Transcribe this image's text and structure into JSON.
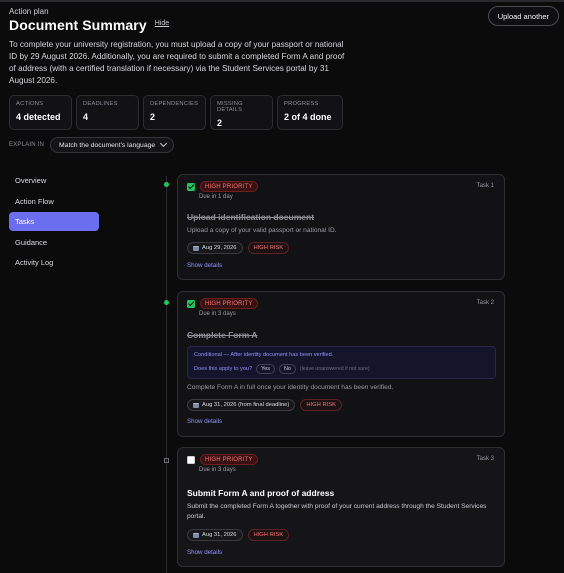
{
  "header": {
    "eyebrow": "Action plan",
    "title": "Document Summary",
    "hide_label": "Hide",
    "upload_label": "Upload another"
  },
  "summary_text": "To complete your university registration, you must upload a copy of your passport or national ID by 29 August 2026. Additionally, you are required to submit a completed Form A and proof of address (with a certified translation if necessary) via the Student Services portal by 31 August 2026.",
  "stats": [
    {
      "label": "ACTIONS",
      "value": "4 detected"
    },
    {
      "label": "DEADLINES",
      "value": "4"
    },
    {
      "label": "DEPENDENCIES",
      "value": "2"
    },
    {
      "label": "MISSING DETAILS",
      "value": "2"
    },
    {
      "label": "PROGRESS",
      "value": "2 of 4 done"
    }
  ],
  "explain": {
    "label": "EXPLAIN IN",
    "selected": "Match the document's language"
  },
  "nav": {
    "items": [
      {
        "label": "Overview",
        "active": false
      },
      {
        "label": "Action Flow",
        "active": false
      },
      {
        "label": "Tasks",
        "active": true
      },
      {
        "label": "Guidance",
        "active": false
      },
      {
        "label": "Activity Log",
        "active": false
      }
    ]
  },
  "tasks": [
    {
      "priority": "HIGH PRIORITY",
      "due": "Due in 1 day",
      "number": "Task 1",
      "title": "Upload identification document",
      "done": true,
      "description": "Upload a copy of your valid passport or national ID.",
      "date_chip": "Aug 29, 2026",
      "risk": "HIGH RISK",
      "show_details": "Show details"
    },
    {
      "priority": "HIGH PRIORITY",
      "due": "Due in 3 days",
      "number": "Task 2",
      "title": "Complete Form A",
      "done": true,
      "conditional": "Conditional — After identity document has been verified.",
      "question": "Does this apply to you?",
      "yes": "Yes",
      "no": "No",
      "note": "(leave unanswered if not sure)",
      "description": "Complete Form A in full once your identity document has been verified.",
      "date_chip": "Aug 31, 2026 (from final deadline)",
      "risk": "HIGH RISK",
      "show_details": "Show details"
    },
    {
      "priority": "HIGH PRIORITY",
      "due": "Due in 3 days",
      "number": "Task 3",
      "title": "Submit Form A and proof of address",
      "done": false,
      "description": "Submit the completed Form A together with proof of your current address through the Student Services portal.",
      "date_chip": "Aug 31, 2026",
      "risk": "HIGH RISK",
      "show_details": "Show details"
    }
  ],
  "colors": {
    "accent": "#6c6ef0",
    "done_green": "#22c55e",
    "risk_red": "#f87171",
    "link": "#8f93ff"
  }
}
